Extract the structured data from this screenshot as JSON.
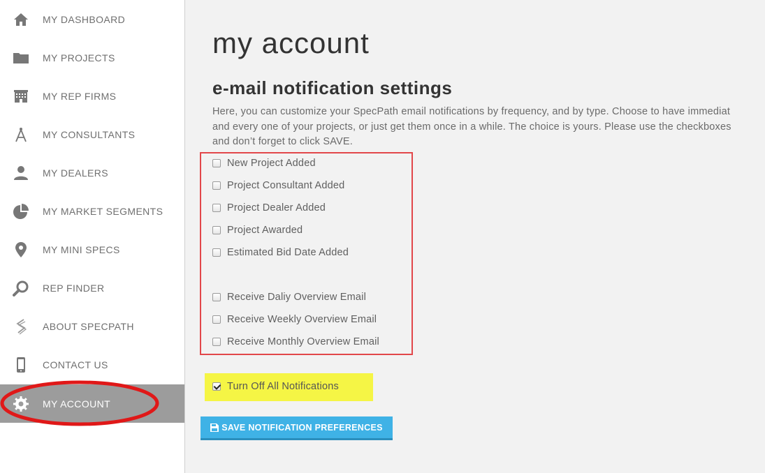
{
  "sidebar": {
    "items": [
      {
        "label": "MY DASHBOARD",
        "icon": "home-icon"
      },
      {
        "label": "MY PROJECTS",
        "icon": "folder-icon"
      },
      {
        "label": "MY REP FIRMS",
        "icon": "building-icon"
      },
      {
        "label": "MY CONSULTANTS",
        "icon": "compass-icon"
      },
      {
        "label": "MY DEALERS",
        "icon": "user-icon"
      },
      {
        "label": "MY MARKET SEGMENTS",
        "icon": "pie-chart-icon"
      },
      {
        "label": "MY MINI SPECS",
        "icon": "map-pin-icon"
      },
      {
        "label": "REP FINDER",
        "icon": "search-icon"
      },
      {
        "label": "ABOUT SPECPATH",
        "icon": "specpath-logo-icon"
      },
      {
        "label": "CONTACT US",
        "icon": "phone-icon"
      },
      {
        "label": "MY ACCOUNT",
        "icon": "gear-icon",
        "active": true
      }
    ]
  },
  "main": {
    "title": "my account",
    "section_title": "e-mail notification settings",
    "description": [
      "Here, you can customize your SpecPath email notifications by frequency, and by type. Choose to have immediat",
      "and every one of your projects, or just get them once in a while. The choice is yours. Please use the checkboxes",
      "and don’t forget to click SAVE."
    ],
    "options": [
      {
        "label": "New Project Added",
        "checked": false
      },
      {
        "label": "Project Consultant Added",
        "checked": false
      },
      {
        "label": "Project Dealer Added",
        "checked": false
      },
      {
        "label": "Project Awarded",
        "checked": false
      },
      {
        "label": "Estimated Bid Date Added",
        "checked": false
      },
      {
        "label": "Receive Daliy Overview Email",
        "checked": false
      },
      {
        "label": "Receive Weekly Overview Email",
        "checked": false
      },
      {
        "label": "Receive Monthly Overview Email",
        "checked": false
      }
    ],
    "turn_off_all": {
      "label": "Turn Off All Notifications",
      "checked": true
    },
    "save_button": {
      "label": "SAVE NOTIFICATION PREFERENCES",
      "icon": "floppy-disk-icon"
    }
  },
  "colors": {
    "sidebar_active": "#9c9c9c",
    "annotation_red": "#e2474a",
    "highlight_yellow": "#f5f545",
    "button_blue": "#3fb2e6"
  }
}
